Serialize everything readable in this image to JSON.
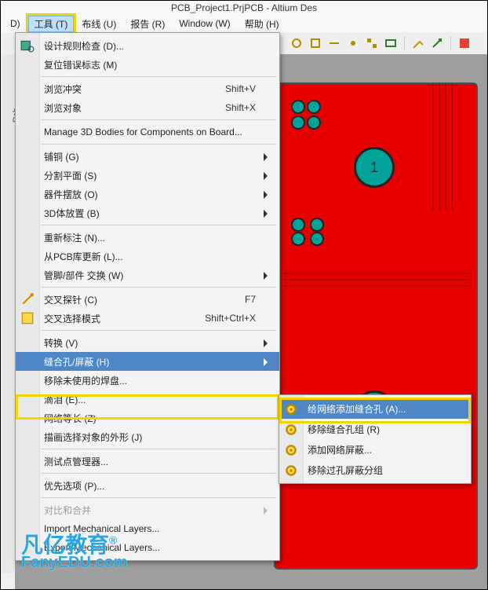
{
  "title": "PCB_Project1.PrjPCB - Altium Des",
  "menu": {
    "d": "D)",
    "tools": "工具 (T)",
    "route": "布线 (U)",
    "report": "报告 (R)",
    "window": "Window (W)",
    "help": "帮助 (H)"
  },
  "leftstrip": ".Pcb",
  "dropdown": {
    "drc": "设计规则检查 (D)...",
    "reset_err": "复位错误标志 (M)",
    "browse_conf": "浏览冲突",
    "browse_conf_sc": "Shift+V",
    "browse_obj": "浏览对象",
    "browse_obj_sc": "Shift+X",
    "manage3d": "Manage 3D Bodies for Components on Board...",
    "polygon": "铺铜 (G)",
    "split": "分割平面 (S)",
    "placement": "器件摆放 (O)",
    "body3d": "3D体放置 (B)",
    "reannotate": "重新标注 (N)...",
    "update_lib": "从PCB库更新 (L)...",
    "pin_swap": "管脚/部件 交换 (W)",
    "crossprobe": "交叉探针 (C)",
    "crossprobe_sc": "F7",
    "crosssel": "交叉选择模式",
    "crosssel_sc": "Shift+Ctrl+X",
    "convert": "转换 (V)",
    "stitching": "缝合孔/屏蔽 (H)",
    "remove_unused": "移除未使用的焊盘...",
    "teardrop": "滴泪 (E)...",
    "equalize": "网络等长 (Z)",
    "outline": "描画选择对象的外形 (J)",
    "testpoint": "测试点管理器...",
    "prefs": "优先选项 (P)...",
    "compare": "对比和合并",
    "import_mech": "Import Mechanical Layers...",
    "export_mech": "Export Mechanical Layers..."
  },
  "submenu": {
    "add_net": "给网络添加缝合孔 (A)...",
    "remove_group": "移除缝合孔组 (R)",
    "add_shield": "添加网络屏蔽...",
    "remove_shield": "移除过孔屏蔽分组"
  },
  "pcb": {
    "pad_label": "1"
  },
  "watermark": {
    "line1": "凡亿教育",
    "reg": "®",
    "line2": "FanyEDU.com"
  }
}
